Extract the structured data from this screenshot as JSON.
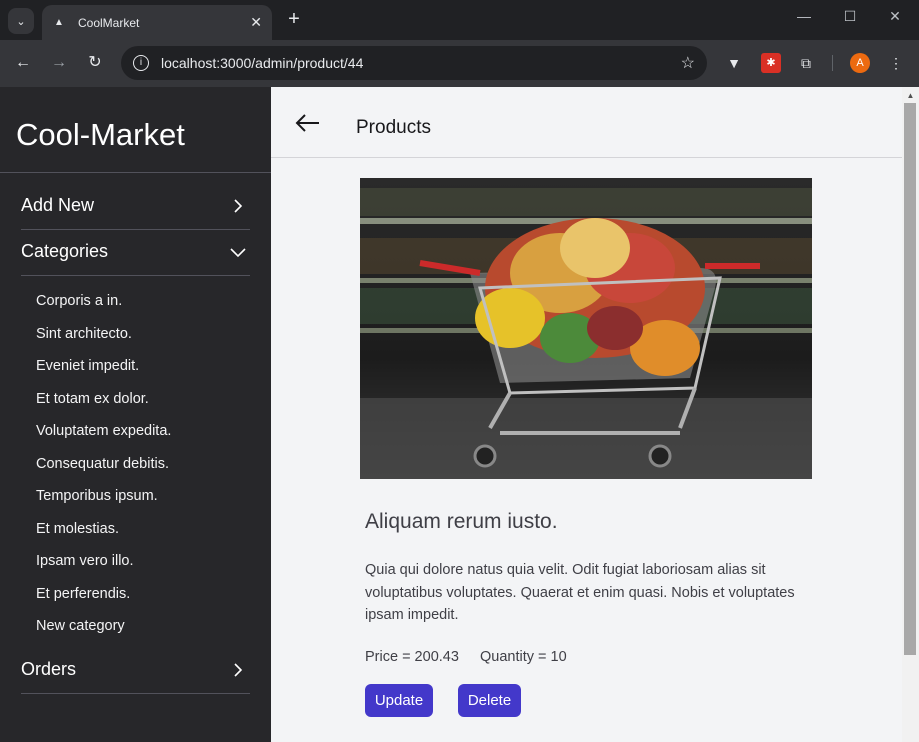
{
  "browser": {
    "tab_title": "CoolMarket",
    "url": "localhost:3000/admin/product/44",
    "profile_initial": "A"
  },
  "sidebar": {
    "brand": "Cool-Market",
    "menu": [
      {
        "label": "Add New",
        "state": "collapsed"
      },
      {
        "label": "Categories",
        "state": "expanded"
      },
      {
        "label": "Orders",
        "state": "collapsed"
      }
    ],
    "categories": [
      "Corporis a in.",
      "Sint architecto.",
      "Eveniet impedit.",
      "Et totam ex dolor.",
      "Voluptatem expedita.",
      "Consequatur debitis.",
      "Temporibus ipsum.",
      "Et molestias.",
      "Ipsam vero illo.",
      "Et perferendis.",
      "New category"
    ]
  },
  "header": {
    "title": "Products"
  },
  "product": {
    "name": "Aliquam rerum iusto.",
    "description": "Quia qui dolore natus quia velit. Odit fugiat laboriosam alias sit voluptatibus voluptates. Quaerat et enim quasi. Nobis et voluptates ipsam impedit.",
    "price_text": "Price = 200.43",
    "quantity_text": "Quantity = 10"
  },
  "actions": {
    "update_label": "Update",
    "delete_label": "Delete"
  },
  "colors": {
    "sidebar_bg": "#27272a",
    "accent": "#4338ca",
    "page_bg": "#f3f4f6"
  }
}
